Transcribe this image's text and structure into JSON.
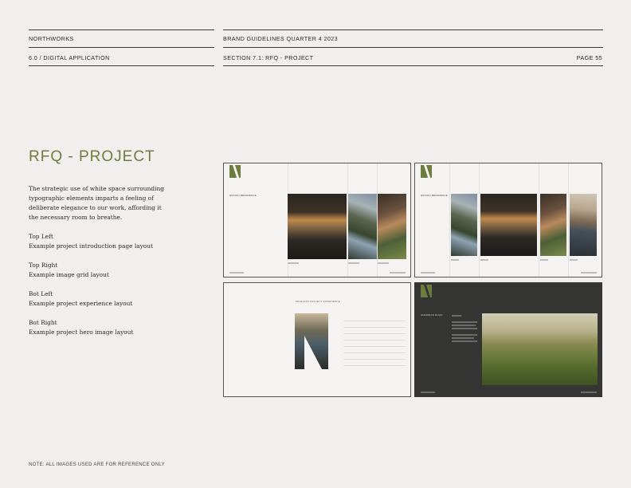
{
  "header": {
    "brand": "NORTHWORKS",
    "doc_title": "BRAND GUIDELINES QUARTER 4 2023",
    "section_left": "6.0 / DIGITAL APPLICATION",
    "section_mid": "SECTION 7.1: RFQ - PROJECT",
    "page": "PAGE 55"
  },
  "main": {
    "title": "RFQ - PROJECT",
    "intro": "The strategic use of white space surrounding typographic elements imparts a feeling of deliberate elegance to our work, affording it the necessary room to breathe.",
    "items": [
      {
        "heading": "Top Left",
        "desc": "Example project introduction page layout"
      },
      {
        "heading": "Top Right",
        "desc": "Example image grid layout"
      },
      {
        "heading": "Bot Left",
        "desc": "Example project experience layout"
      },
      {
        "heading": "Bot Right",
        "desc": "Example project hero image layout"
      }
    ]
  },
  "thumbnails": {
    "top_left_label": "DESIGN REFERENCE",
    "top_right_label": "DESIGN REFERENCE",
    "bot_left_label": "RELEVANT PROJECT EXPERIENCE",
    "bot_right_label": "SHERIDAN ROAD"
  },
  "footer": {
    "note": "NOTE: ALL IMAGES USED ARE FOR REFERENCE ONLY"
  },
  "colors": {
    "accent": "#6e7d3d",
    "background": "#f0efed",
    "dark_panel": "#353634"
  }
}
